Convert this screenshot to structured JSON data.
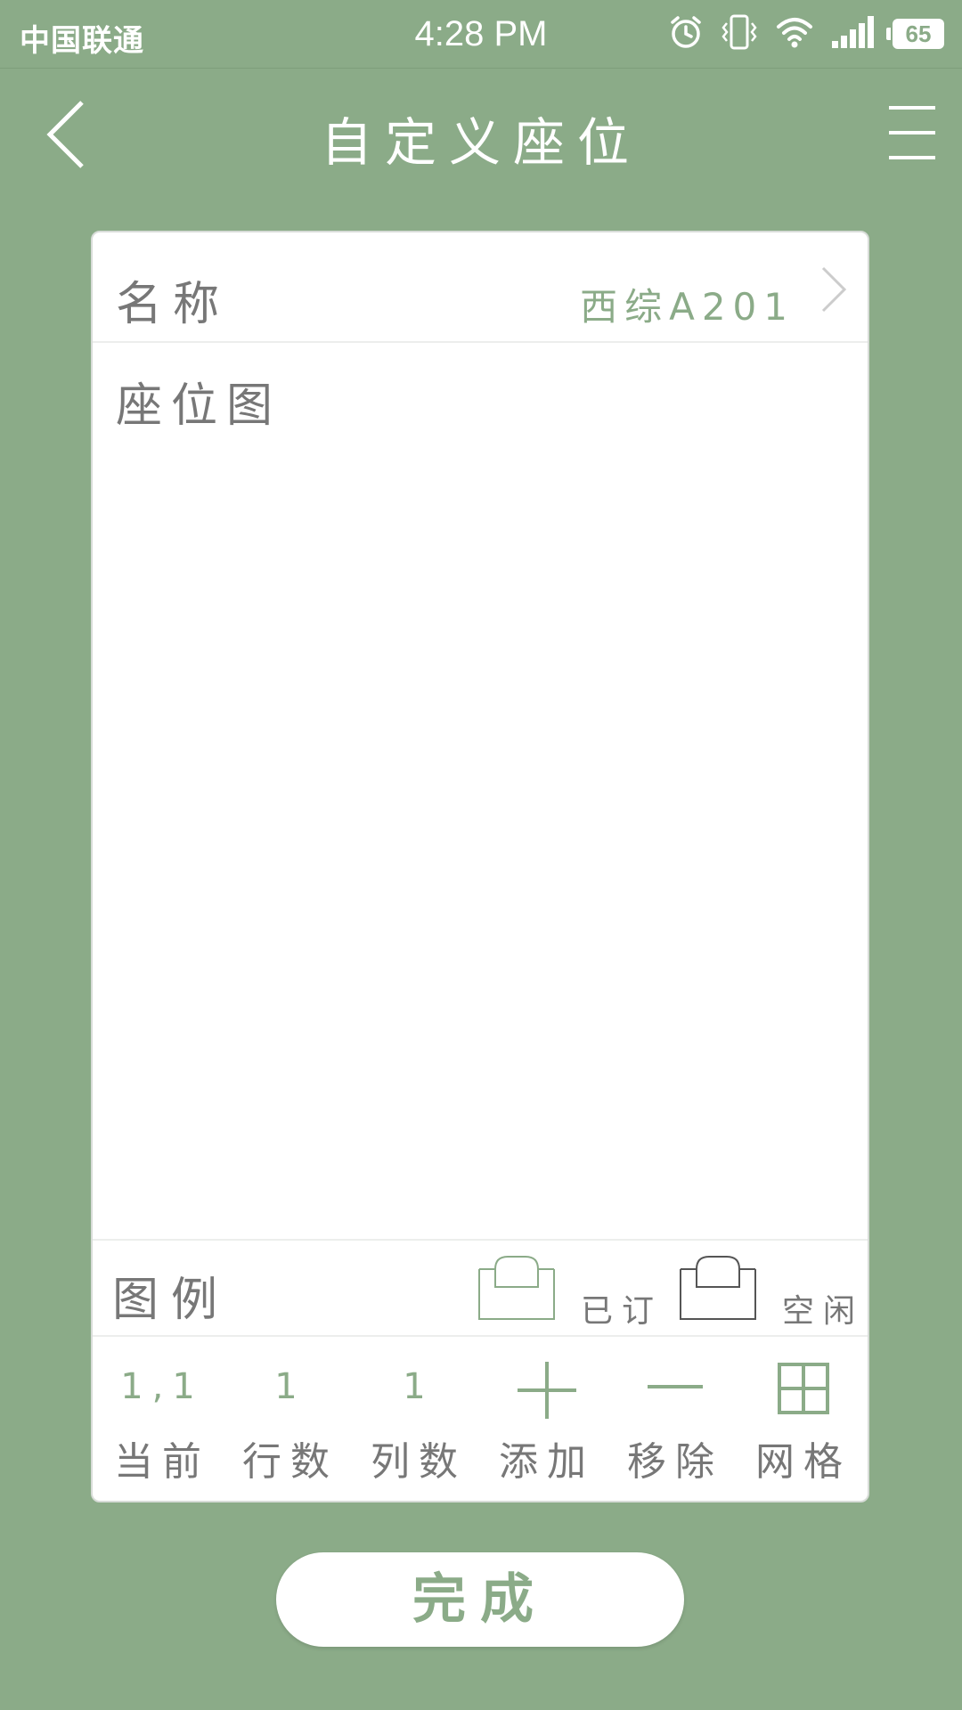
{
  "status_bar": {
    "carrier": "中国联通",
    "time": "4:28 PM",
    "battery": "65",
    "icons": [
      "alarm-icon",
      "vibrate-icon",
      "wifi-icon",
      "signal-icon",
      "battery-icon"
    ]
  },
  "header": {
    "title": "自定义座位",
    "back_icon": "chevron-left-icon",
    "menu_icon": "hamburger-menu-icon"
  },
  "card": {
    "name_label": "名称",
    "name_value": "西综A201",
    "map_label": "座位图",
    "legend_label": "图例",
    "legend": [
      {
        "label": "已订",
        "icon": "seat-booked-icon",
        "color": "#8bab88"
      },
      {
        "label": "空闲",
        "icon": "seat-free-icon",
        "color": "#555555"
      }
    ]
  },
  "toolbar": {
    "current": {
      "value": "1,1",
      "label": "当前"
    },
    "rows": {
      "value": "1",
      "label": "行数"
    },
    "cols": {
      "value": "1",
      "label": "列数"
    },
    "add": {
      "icon": "plus-icon",
      "label": "添加"
    },
    "remove": {
      "icon": "minus-icon",
      "label": "移除"
    },
    "grid": {
      "icon": "grid-icon",
      "label": "网格"
    }
  },
  "done_button": "完成",
  "colors": {
    "background": "#8bab88",
    "accent": "#8bab88",
    "text_gray": "#777777",
    "card": "#ffffff"
  }
}
